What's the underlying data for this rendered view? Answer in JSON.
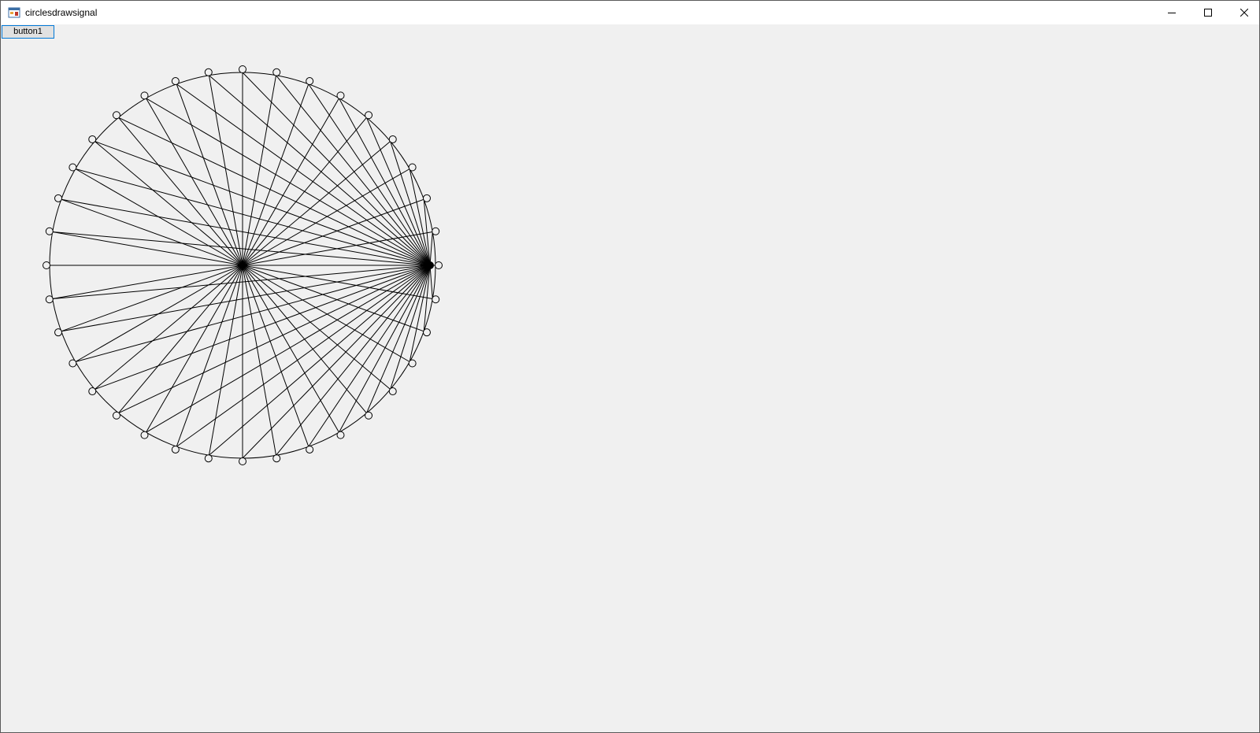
{
  "window": {
    "title": "circlesdrawsignal",
    "icon": "winforms-app-icon"
  },
  "caption_buttons": {
    "minimize_icon": "minimize-icon",
    "maximize_icon": "maximize-icon",
    "close_icon": "close-icon"
  },
  "form": {
    "button1_label": "button1"
  },
  "drawing": {
    "marker_count": 36,
    "stroke_color": "#000000",
    "background_color": "#f0f0f0"
  }
}
